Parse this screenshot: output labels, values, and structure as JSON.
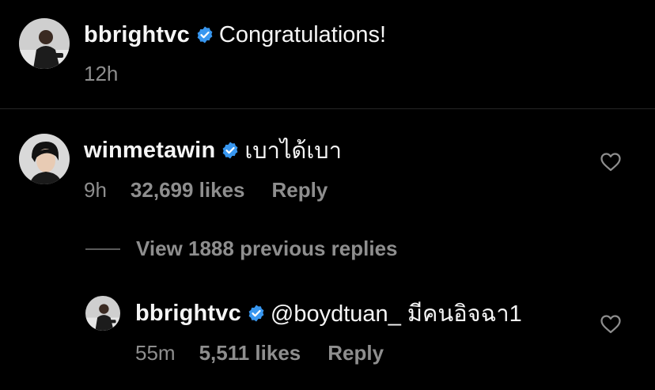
{
  "caption": {
    "username": "bbrightvc",
    "text": "Congratulations!",
    "time": "12h"
  },
  "comment": {
    "username": "winmetawin",
    "text": "เบาได้เบา",
    "time": "9h",
    "likes": "32,699 likes",
    "reply_label": "Reply"
  },
  "view_replies_label": "View 1888 previous replies",
  "reply": {
    "username": "bbrightvc",
    "text": "@boydtuan_ มีคนอิจฉา1",
    "time": "55m",
    "likes": "5,511 likes",
    "reply_label": "Reply"
  },
  "colors": {
    "background": "#000000",
    "primary_text": "#f5f5f5",
    "secondary_text": "#8e8e8e",
    "verified_blue": "#3897f0"
  }
}
